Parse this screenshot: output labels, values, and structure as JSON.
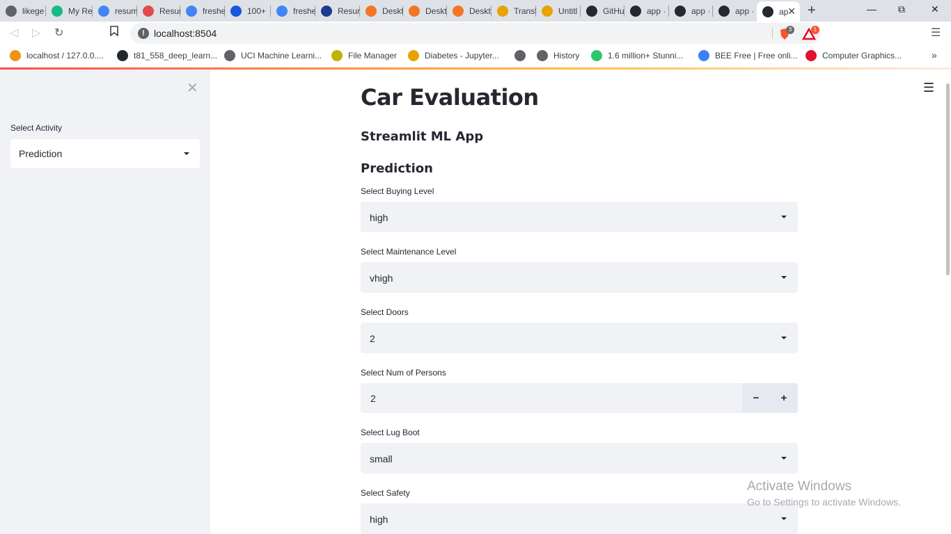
{
  "browser": {
    "tabs": [
      {
        "label": "likege",
        "icon": "globe-icon",
        "color": "#5f6368"
      },
      {
        "label": "My Re",
        "icon": "resume-icon",
        "color": "#1bb985"
      },
      {
        "label": "resum",
        "icon": "google-icon",
        "color": "#4285f4"
      },
      {
        "label": "Resun",
        "icon": "resume-doc-icon",
        "color": "#e04a4a"
      },
      {
        "label": "freshe",
        "icon": "google-icon",
        "color": "#4285f4"
      },
      {
        "label": "100+",
        "icon": "r-letter-icon",
        "color": "#1a56db"
      },
      {
        "label": "freshe",
        "icon": "google-icon",
        "color": "#4285f4"
      },
      {
        "label": "Resun",
        "icon": "kickresume-icon",
        "color": "#1e3a8a"
      },
      {
        "label": "Deskt",
        "icon": "jupyter-icon",
        "color": "#f37626"
      },
      {
        "label": "Deskt",
        "icon": "jupyter-icon",
        "color": "#f37626"
      },
      {
        "label": "Deskt",
        "icon": "jupyter-icon",
        "color": "#f37626"
      },
      {
        "label": "Transf",
        "icon": "notebook-icon",
        "color": "#e8a300"
      },
      {
        "label": "Untitl",
        "icon": "notebook-icon",
        "color": "#e8a300"
      },
      {
        "label": "GitHu",
        "icon": "github-icon",
        "color": "#24292e"
      },
      {
        "label": "app ·",
        "icon": "streamlit-icon",
        "color": "#262730"
      },
      {
        "label": "app ·",
        "icon": "streamlit-icon",
        "color": "#262730"
      },
      {
        "label": "app ·",
        "icon": "streamlit-icon",
        "color": "#262730"
      },
      {
        "label": "ap",
        "icon": "streamlit-icon",
        "color": "#262730"
      }
    ],
    "new_tab_label": "+",
    "url": "localhost:8504",
    "brave_shield_count": "3",
    "brave_rewards_count": "1",
    "bookmarks": [
      {
        "label": "localhost / 127.0.0....",
        "icon": "phpmyadmin-icon",
        "color": "#f29111"
      },
      {
        "label": "t81_558_deep_learn...",
        "icon": "github-icon",
        "color": "#24292e"
      },
      {
        "label": "UCI Machine Learni...",
        "icon": "globe-icon",
        "color": "#5f6368"
      },
      {
        "label": "File Manager",
        "icon": "file-manager-icon",
        "color": "#c4b000"
      },
      {
        "label": "Diabetes - Jupyter...",
        "icon": "notebook-icon",
        "color": "#e8a300"
      },
      {
        "label": "",
        "icon": "globe-icon",
        "color": "#5f6368"
      },
      {
        "label": "History",
        "icon": "history-icon",
        "color": "#5f6368"
      },
      {
        "label": "1.6 million+ Stunni...",
        "icon": "pixabay-icon",
        "color": "#2ec66d"
      },
      {
        "label": "BEE Free | Free onli...",
        "icon": "bee-icon",
        "color": "#3b82f6"
      },
      {
        "label": "Computer Graphics...",
        "icon": "tutorialspoint-icon",
        "color": "#e0102f"
      }
    ]
  },
  "sidebar": {
    "label": "Select Activity",
    "selected": "Prediction"
  },
  "main": {
    "title": "Car Evaluation",
    "subtitle": "Streamlit ML App",
    "section": "Prediction",
    "fields": {
      "buying": {
        "label": "Select Buying Level",
        "value": "high"
      },
      "maint": {
        "label": "Select Maintenance Level",
        "value": "vhigh"
      },
      "doors": {
        "label": "Select Doors",
        "value": "2"
      },
      "persons": {
        "label": "Select Num of Persons",
        "value": "2",
        "minus": "−",
        "plus": "+"
      },
      "lug_boot": {
        "label": "Select Lug Boot",
        "value": "small"
      },
      "safety": {
        "label": "Select Safety",
        "value": "high"
      }
    }
  },
  "os_watermark": {
    "line1": "Activate Windows",
    "line2": "Go to Settings to activate Windows."
  }
}
